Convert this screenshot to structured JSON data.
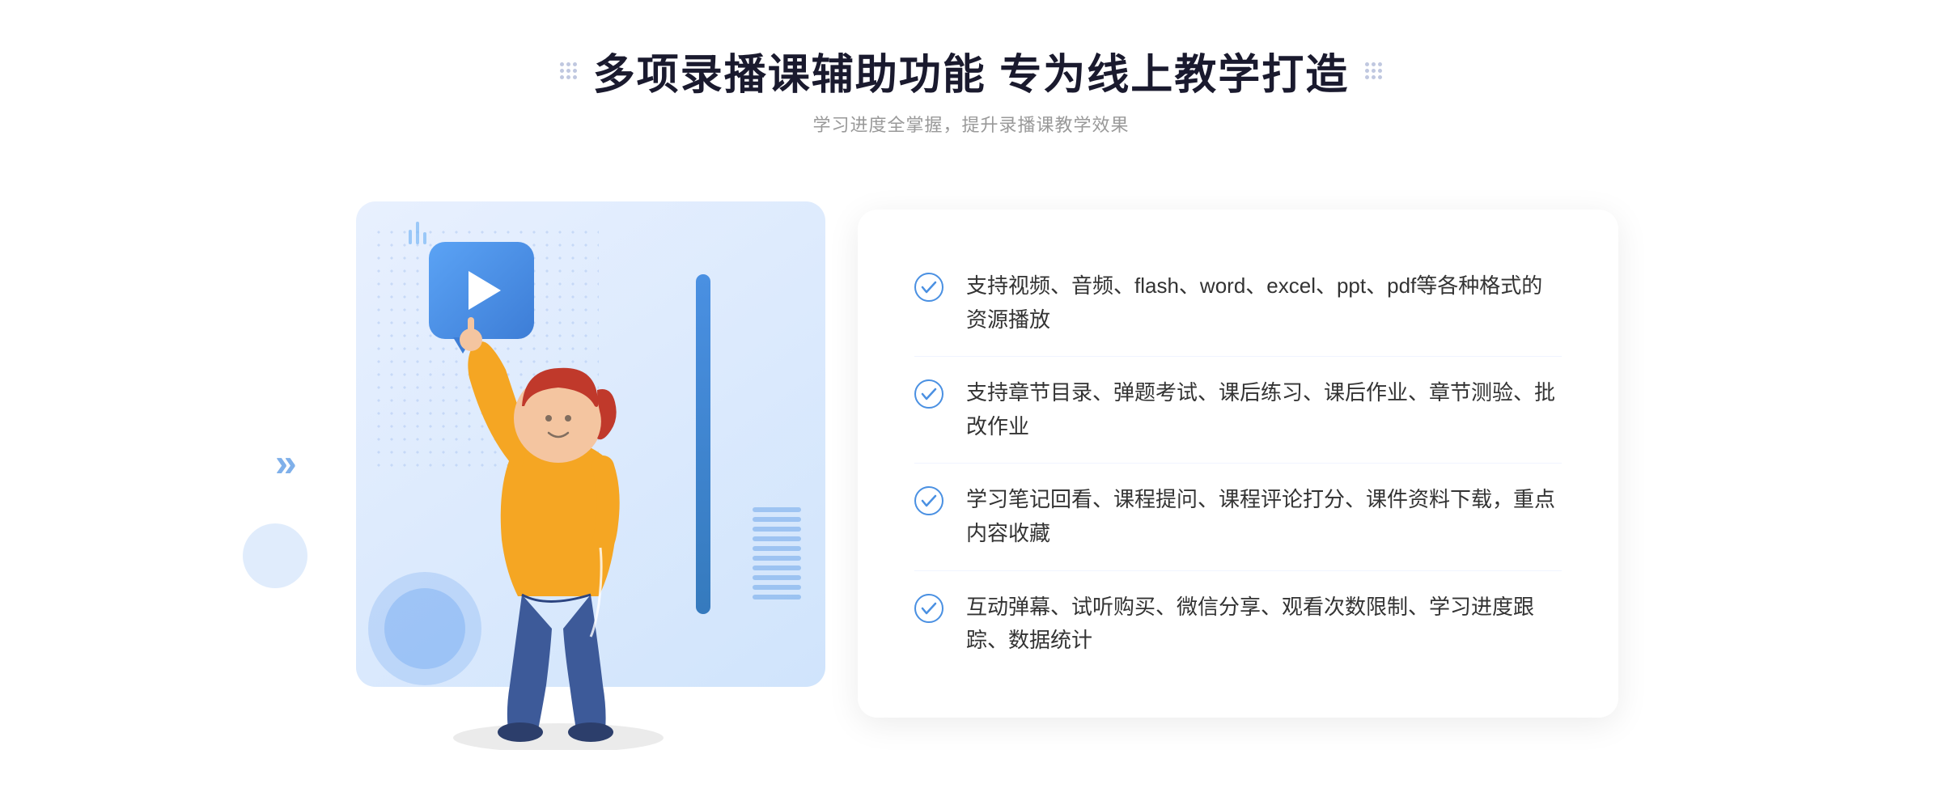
{
  "header": {
    "title": "多项录播课辅助功能 专为线上教学打造",
    "subtitle": "学习进度全掌握，提升录播课教学效果"
  },
  "features": [
    {
      "id": "feature-1",
      "text": "支持视频、音频、flash、word、excel、ppt、pdf等各种格式的资源播放"
    },
    {
      "id": "feature-2",
      "text": "支持章节目录、弹题考试、课后练习、课后作业、章节测验、批改作业"
    },
    {
      "id": "feature-3",
      "text": "学习笔记回看、课程提问、课程评论打分、课件资料下载，重点内容收藏"
    },
    {
      "id": "feature-4",
      "text": "互动弹幕、试听购买、微信分享、观看次数限制、学习进度跟踪、数据统计"
    }
  ],
  "colors": {
    "primary_blue": "#4a90e2",
    "light_blue": "#e8f0fe",
    "text_dark": "#1a1a2e",
    "text_sub": "#999999",
    "text_feature": "#333333",
    "check_color": "#4a90e2"
  },
  "decorations": {
    "left_chevron": "»",
    "dot_grid_count": 9
  }
}
